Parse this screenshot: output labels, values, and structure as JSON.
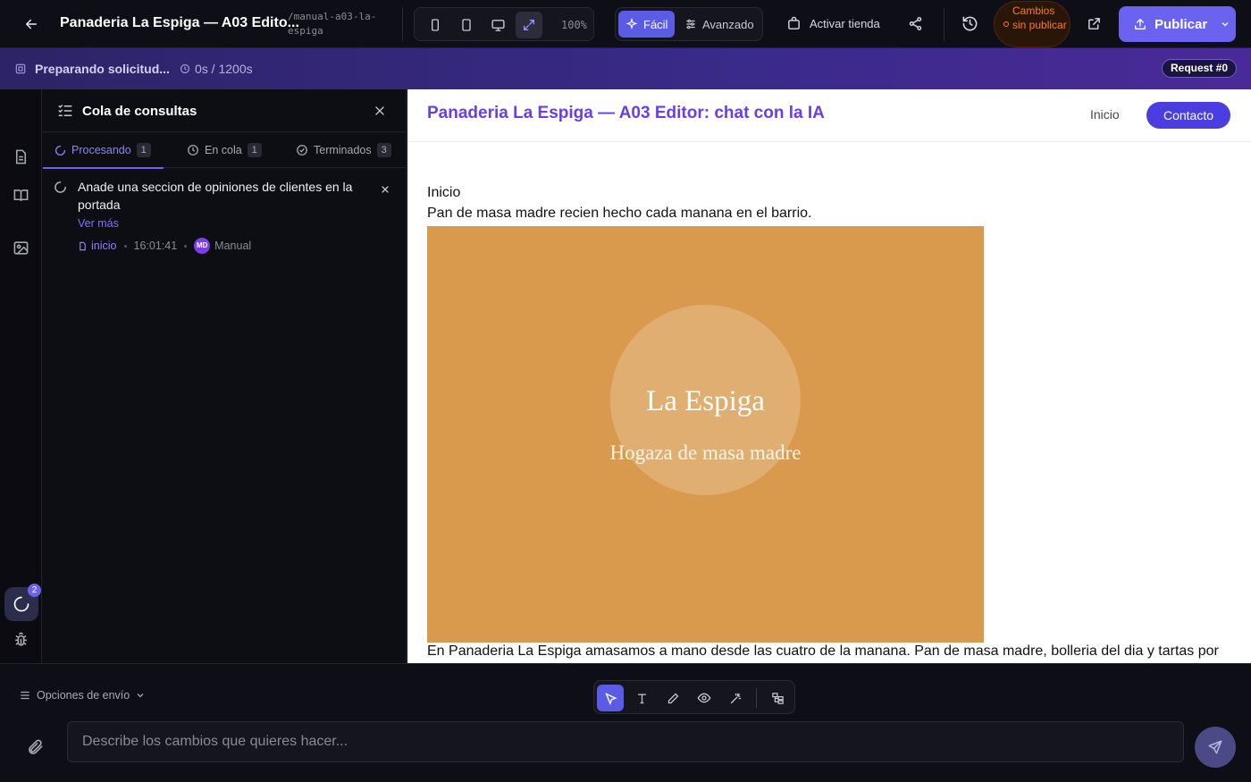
{
  "topbar": {
    "title": "Panaderia La Espiga — A03 Edito...",
    "slug": "/manual-a03-la-espiga",
    "zoom": "100%",
    "mode_easy": "Fácil",
    "mode_advanced": "Avanzado",
    "activate_store": "Activar tienda",
    "unpublished": "Cambios sin publicar",
    "publish": "Publicar"
  },
  "status": {
    "title": "Preparando solicitud...",
    "time": "0s / 1200s",
    "request": "Request #0"
  },
  "rail": {
    "queue_badge": "2"
  },
  "queue": {
    "title": "Cola de consultas",
    "tabs": [
      {
        "label": "Procesando",
        "count": "1"
      },
      {
        "label": "En cola",
        "count": "1"
      },
      {
        "label": "Terminados",
        "count": "3"
      }
    ],
    "task": {
      "text": "Anade una seccion de opiniones de clientes en la portada",
      "more": "Ver más",
      "page": "inicio",
      "time": "16:01:41",
      "avatar": "MD",
      "author": "Manual"
    }
  },
  "preview": {
    "brand": "Panaderia La Espiga — A03 Editor: chat con la IA",
    "nav_home": "Inicio",
    "nav_contact": "Contacto",
    "heading": "Inicio",
    "subheading": "Pan de masa madre recien hecho cada manana en el barrio.",
    "hero_title": "La Espiga",
    "hero_subtitle": "Hogaza de masa madre",
    "body": "En Panaderia La Espiga amasamos a mano desde las cuatro de la manana. Pan de masa madre, bolleria del dia y tartas por"
  },
  "composer": {
    "send_options": "Opciones de envío",
    "placeholder": "Describe los cambios que quieres hacer..."
  },
  "colors": {
    "accent": "#6b63f0",
    "warning": "#ff7a1a",
    "hero": "#d99a4d",
    "brand_text": "#6a3ee6"
  }
}
